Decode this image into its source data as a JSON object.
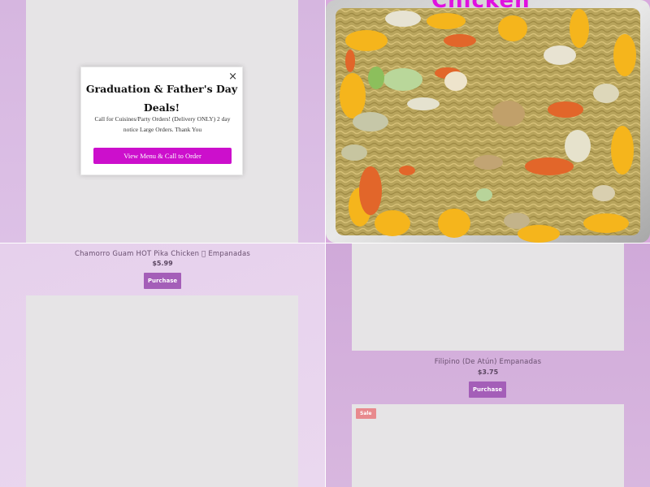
{
  "popup": {
    "title": "Graduation & Father's Day Deals!",
    "message": "Call for Cuisines/Party Orders! (Delivery ONLY) 2 day notice Large Orders. Thank You",
    "button_label": "View Menu & Call to Order",
    "close_label": "×"
  },
  "products": [
    {
      "name": "Chamorro Guam HOT Pika Chicken \u0000 Empanadas",
      "price": "$5.99",
      "purchase_label": "Purchase"
    },
    {
      "name": "Filipino (De Atún) Empanadas",
      "price": "$3.75",
      "purchase_label": "Purchase"
    }
  ],
  "sale_badge": "Sale",
  "photo_caption": "Chicken",
  "colors": {
    "accent_purple": "#a45eb8",
    "popup_button": "#cc0fcc",
    "sale_badge": "#e88a8e",
    "background_lavender": "#d6b6e0"
  }
}
